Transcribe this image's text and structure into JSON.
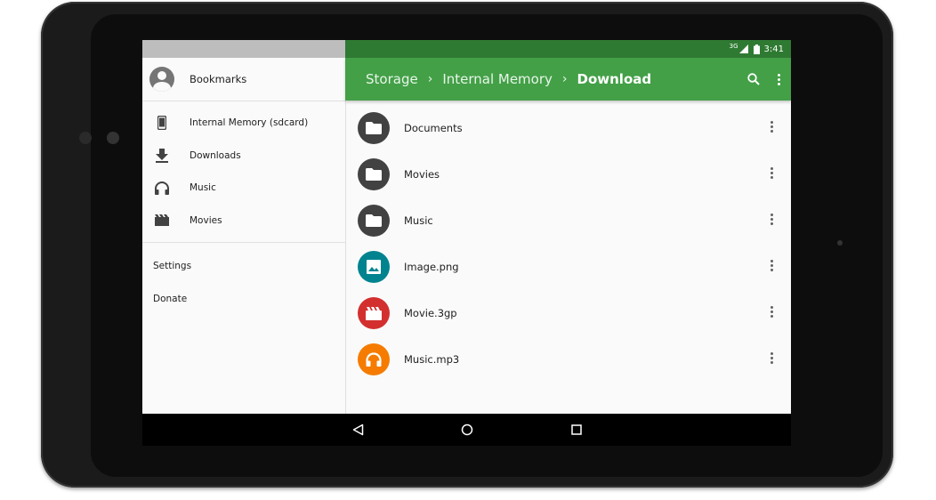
{
  "status": {
    "network": "3G",
    "time": "3:41"
  },
  "drawer": {
    "header_label": "Bookmarks",
    "items": [
      {
        "label": "Internal Memory (sdcard)",
        "icon": "phone-icon"
      },
      {
        "label": "Downloads",
        "icon": "download-icon"
      },
      {
        "label": "Music",
        "icon": "headphones-icon"
      },
      {
        "label": "Movies",
        "icon": "movie-icon"
      }
    ],
    "secondary": [
      {
        "label": "Settings"
      },
      {
        "label": "Donate"
      }
    ]
  },
  "toolbar": {
    "breadcrumbs": [
      "Storage",
      "Internal Memory",
      "Download"
    ],
    "accent": "#43a047",
    "status_color": "#2f7a32"
  },
  "files": [
    {
      "name": "Documents",
      "icon": "folder-icon",
      "color": "#424242"
    },
    {
      "name": "Movies",
      "icon": "folder-icon",
      "color": "#424242"
    },
    {
      "name": "Music",
      "icon": "folder-icon",
      "color": "#424242"
    },
    {
      "name": "Image.png",
      "icon": "image-icon",
      "color": "#00838f"
    },
    {
      "name": "Movie.3gp",
      "icon": "video-icon",
      "color": "#d32f2f"
    },
    {
      "name": "Music.mp3",
      "icon": "audio-icon",
      "color": "#f57c00"
    }
  ]
}
